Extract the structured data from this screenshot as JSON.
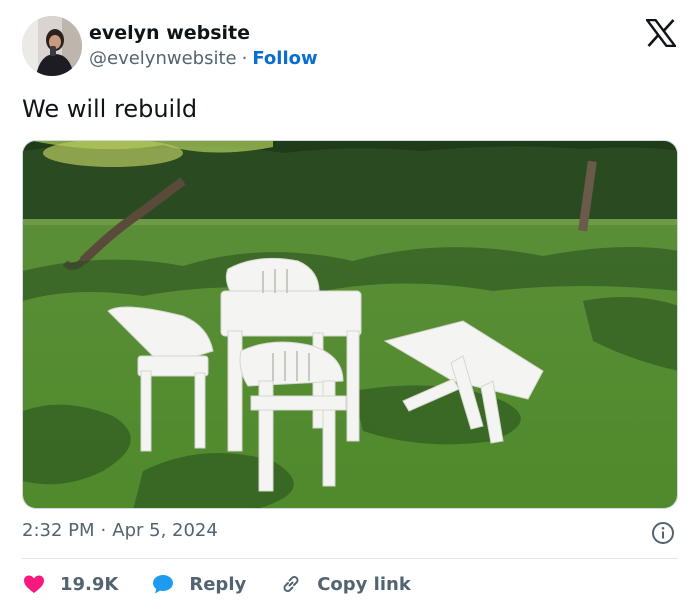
{
  "author": {
    "display_name": "evelyn website",
    "handle": "@evelynwebsite",
    "separator": "·",
    "follow_label": "Follow"
  },
  "brand": {
    "logo_icon": "x-logo-icon"
  },
  "tweet": {
    "text": "We will rebuild",
    "media_description_icon": "photo"
  },
  "meta": {
    "time": "2:32 PM",
    "separator": "·",
    "date": "Apr 5, 2024",
    "info_icon": "info-icon"
  },
  "actions": {
    "like": {
      "icon": "heart-icon",
      "label": "19.9K",
      "color": "#f91880"
    },
    "reply": {
      "icon": "speech-bubble-icon",
      "label": "Reply",
      "color": "#1d9bf0"
    },
    "copy": {
      "icon": "link-icon",
      "label": "Copy link"
    }
  },
  "colors": {
    "text_primary": "#0f1419",
    "text_secondary": "#536471",
    "link_blue": "#0a6ed1",
    "divider": "#e1e8ed"
  }
}
